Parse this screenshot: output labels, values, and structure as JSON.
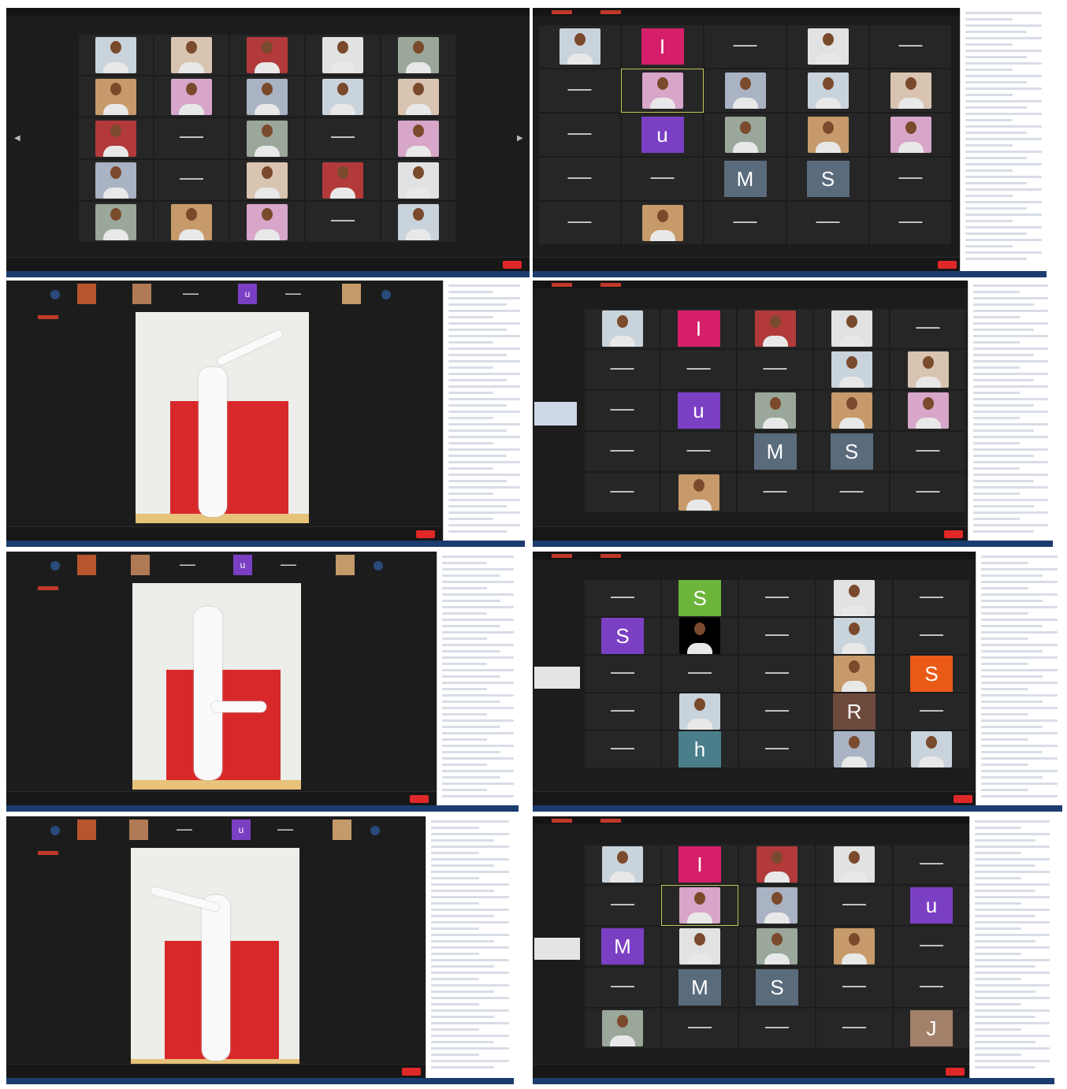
{
  "colors": {
    "pink": "#d61f6a",
    "purple": "#7b3fc4",
    "slate": "#5a6b7c",
    "green": "#6cb43a",
    "orange": "#ea5a17",
    "brown": "#6e4a3d",
    "tan": "#a38069",
    "teal": "#4a7e8a"
  },
  "panels": [
    {
      "id": "p1",
      "letters": []
    },
    {
      "id": "p2",
      "letters": [
        "I",
        "u",
        "M",
        "S"
      ]
    },
    {
      "id": "p3",
      "strip_letters": [
        "u"
      ]
    },
    {
      "id": "p4",
      "letters": [
        "I",
        "u",
        "M",
        "S"
      ]
    },
    {
      "id": "p5",
      "strip_letters": [
        "u"
      ]
    },
    {
      "id": "p6",
      "letters": [
        "S",
        "S",
        "S",
        "R",
        "h"
      ]
    },
    {
      "id": "p7",
      "strip_letters": [
        "u"
      ]
    },
    {
      "id": "p8",
      "letters": [
        "I",
        "u",
        "M",
        "M",
        "S",
        "J"
      ]
    }
  ]
}
